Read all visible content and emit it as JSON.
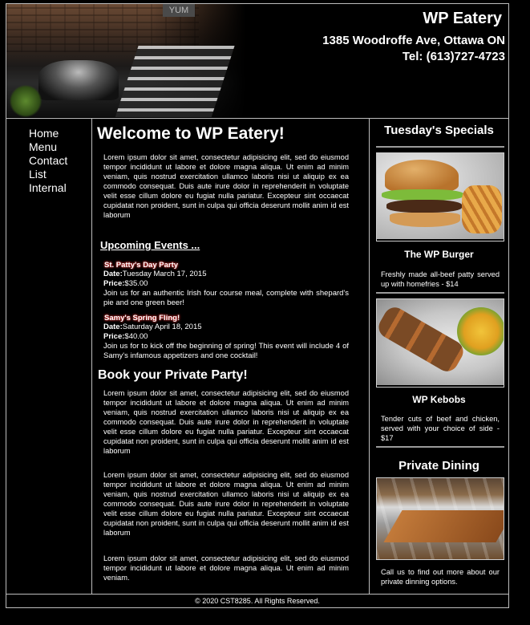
{
  "header": {
    "title": "WP Eatery",
    "address": "1385 Woodroffe Ave, Ottawa ON",
    "phone": "Tel: (613)727-4723",
    "hero_sign": "YUM"
  },
  "nav": {
    "items": [
      "Home",
      "Menu",
      "Contact",
      "List",
      "Internal"
    ]
  },
  "main": {
    "welcome_title": "Welcome to WP Eatery!",
    "intro_text": "Lorem ipsum dolor sit amet, consectetur adipisicing elit, sed do eiusmod tempor incididunt ut labore et dolore magna aliqua. Ut enim ad minim veniam, quis nostrud exercitation ullamco laboris nisi ut aliquip ex ea commodo consequat. Duis aute irure dolor in reprehenderit in voluptate velit esse cillum dolore eu fugiat nulla pariatur. Excepteur sint occaecat cupidatat non proident, sunt in culpa qui officia deserunt mollit anim id est laborum",
    "events_heading": "Upcoming Events ...",
    "events": [
      {
        "title": "St. Patty's Day Party",
        "date_label": "Date:",
        "date": "Tuesday March 17, 2015",
        "price_label": "Price:",
        "price": "$35.00",
        "description": "Join us for an authentic Irish four course meal, complete with shepard's pie and one green beer!"
      },
      {
        "title": "Samy's Spring Fling!",
        "date_label": "Date:",
        "date": "Saturday April 18, 2015",
        "price_label": "Price:",
        "price": "$40.00",
        "description": "Join us for to kick off the beginning of spring! This event will include 4 of Samy's infamous appetizers and one cocktail!"
      }
    ],
    "party_heading": "Book your Private Party!",
    "party_para1": "Lorem ipsum dolor sit amet, consectetur adipisicing elit, sed do eiusmod tempor incididunt ut labore et dolore magna aliqua. Ut enim ad minim veniam, quis nostrud exercitation ullamco laboris nisi ut aliquip ex ea commodo consequat. Duis aute irure dolor in reprehenderit in voluptate velit esse cillum dolore eu fugiat nulla pariatur. Excepteur sint occaecat cupidatat non proident, sunt in culpa qui officia deserunt mollit anim id est laborum",
    "party_para2": "Lorem ipsum dolor sit amet, consectetur adipisicing elit, sed do eiusmod tempor incididunt ut labore et dolore magna aliqua. Ut enim ad minim veniam, quis nostrud exercitation ullamco laboris nisi ut aliquip ex ea commodo consequat. Duis aute irure dolor in reprehenderit in voluptate velit esse cillum dolore eu fugiat nulla pariatur. Excepteur sint occaecat cupidatat non proident, sunt in culpa qui officia deserunt mollit anim id est laborum",
    "party_para3": "Lorem ipsum dolor sit amet, consectetur adipisicing elit, sed do eiusmod tempor incididunt ut labore et dolore magna aliqua. Ut enim ad minim veniam."
  },
  "sidebar": {
    "specials_heading": "Tuesday's Specials",
    "items": [
      {
        "name": "The WP Burger",
        "description": "Freshly made all-beef patty served up with homefries - $14"
      },
      {
        "name": "WP Kebobs",
        "description": "Tender cuts of beef and chicken, served with your choice of side - $17"
      }
    ],
    "private_heading": "Private Dining",
    "private_text": "Call us to find out more about our private dinning options."
  },
  "footer": {
    "text": "© 2020 CST8285. All Rights Reserved."
  }
}
